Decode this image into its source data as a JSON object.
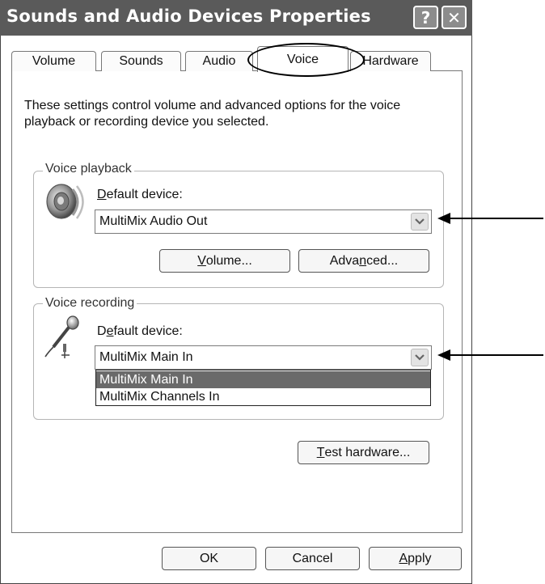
{
  "window": {
    "title": "Sounds and Audio Devices Properties",
    "help_glyph": "?",
    "close_glyph": "✕"
  },
  "tabs": [
    {
      "label": "Volume",
      "selected": false
    },
    {
      "label": "Sounds",
      "selected": false
    },
    {
      "label": "Audio",
      "selected": false
    },
    {
      "label": "Voice",
      "selected": true
    },
    {
      "label": "Hardware",
      "selected": false
    }
  ],
  "description": "These settings control volume and advanced options for the voice playback or recording device you selected.",
  "voice_playback": {
    "legend": "Voice playback",
    "icon": "speaker-icon",
    "device_label_mnemonic": "D",
    "device_label_rest": "efault device:",
    "device_value": "MultiMix Audio Out",
    "volume_button": {
      "pre": "",
      "mnemonic": "V",
      "post": "olume..."
    },
    "advanced_button": {
      "pre": "Adva",
      "mnemonic": "n",
      "post": "ced..."
    }
  },
  "voice_recording": {
    "legend": "Voice recording",
    "icon": "microphone-icon",
    "device_label_pre": "D",
    "device_label_mnemonic": "e",
    "device_label_rest": "fault device:",
    "device_value": "MultiMix Main In",
    "dropdown_options": [
      "MultiMix Main In",
      "MultiMix Channels In"
    ],
    "selected_option_index": 0
  },
  "test_hardware_button": {
    "mnemonic": "T",
    "post": "est hardware..."
  },
  "dialog_buttons": {
    "ok": "OK",
    "cancel": "Cancel",
    "apply_mnemonic": "A",
    "apply_rest": "pply"
  },
  "colors": {
    "titlebar": "#5a5a5a",
    "selection": "#6a6a6a"
  }
}
